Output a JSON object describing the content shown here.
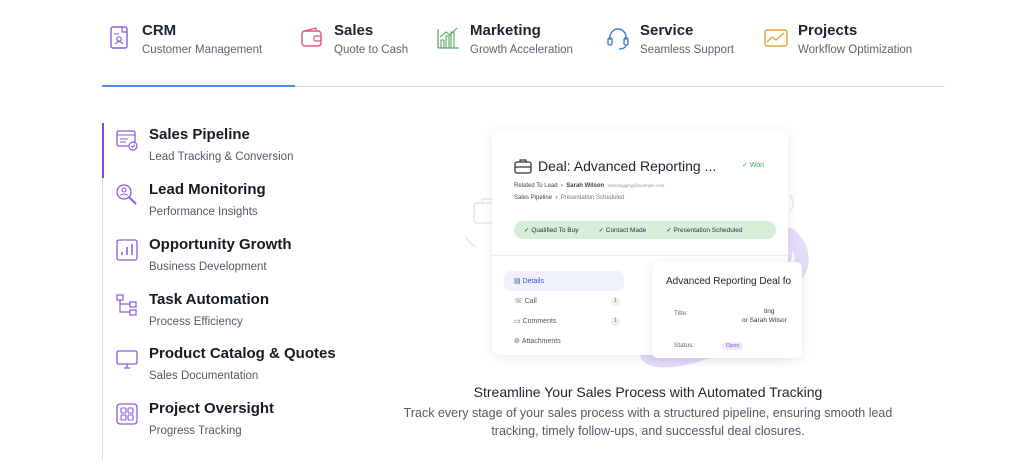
{
  "tabs": [
    {
      "title": "CRM",
      "subtitle": "Customer Management",
      "icon": "crm-document-icon",
      "active": true
    },
    {
      "title": "Sales",
      "subtitle": "Quote to Cash",
      "icon": "wallet-icon"
    },
    {
      "title": "Marketing",
      "subtitle": "Growth Acceleration",
      "icon": "bar-chart-icon"
    },
    {
      "title": "Service",
      "subtitle": "Seamless Support",
      "icon": "headset-icon"
    },
    {
      "title": "Projects",
      "subtitle": "Workflow Optimization",
      "icon": "trend-chart-icon"
    }
  ],
  "menu": [
    {
      "title": "Sales Pipeline",
      "subtitle": "Lead Tracking & Conversion",
      "icon": "pipeline-icon",
      "active": true
    },
    {
      "title": "Lead Monitoring",
      "subtitle": "Performance Insights",
      "icon": "magnifier-icon"
    },
    {
      "title": "Opportunity Growth",
      "subtitle": "Business Development",
      "icon": "growth-chart-icon"
    },
    {
      "title": "Task Automation",
      "subtitle": "Process Efficiency",
      "icon": "workflow-icon"
    },
    {
      "title": "Product Catalog & Quotes",
      "subtitle": "Sales Documentation",
      "icon": "monitor-icon"
    },
    {
      "title": "Project Oversight",
      "subtitle": "Progress Tracking",
      "icon": "grid-icon"
    }
  ],
  "preview": {
    "deal_title": "Deal: Advanced Reporting ...",
    "won_label": "Won",
    "related_label": "Related To Lead",
    "contact_name": "Sarah Wilson",
    "contact_email": "rwdcdogging@example.com",
    "pipeline_label": "Sales Pipeline",
    "pipeline_stage": "Presentation Scheduled",
    "stages": [
      "Qualified To Buy",
      "Contact Made",
      "Presentation Scheduled"
    ],
    "sub_items": [
      {
        "label": "Details",
        "active": true
      },
      {
        "label": "Call",
        "count": "1"
      },
      {
        "label": "Comments",
        "count": "1"
      },
      {
        "label": "Attachments"
      }
    ],
    "detail_title": "Advanced Reporting Deal fo",
    "detail_title_label": "Title:",
    "detail_title_value_1": "ting",
    "detail_title_value_2": "or Sarah Wilsor",
    "detail_status_label": "Status:",
    "detail_status_value": "Open"
  },
  "caption": {
    "title": "Streamline Your Sales Process with Automated Tracking",
    "text": "Track every stage of your sales process with a structured pipeline, ensuring smooth lead tracking, timely follow-ups, and successful deal closures."
  },
  "colors": {
    "accent_purple": "#7c4ddf",
    "tab_underline_blue": "#4a8fe7",
    "stage_green": "#d7eed9",
    "won_green": "#3aa55f"
  }
}
